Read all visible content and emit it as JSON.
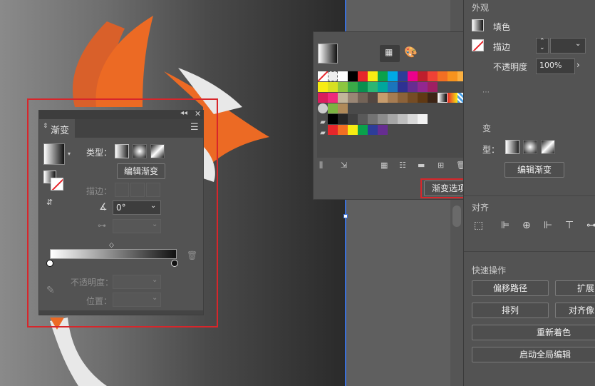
{
  "gradient_panel": {
    "tab_title": "渐变",
    "type_label": "类型：",
    "edit_gradient_button": "编辑渐变",
    "stroke_label": "描边：",
    "angle_value": "0°",
    "opacity_label": "不透明度：",
    "location_label": "位置："
  },
  "swatches_panel": {
    "gradient_options_button": "渐变选项",
    "row1_colors": [
      "#ffffff",
      "#000000",
      "#e7262b",
      "#f7ec13",
      "#0aa14b",
      "#00a9e6",
      "#2d3d98",
      "#ec008c",
      "#be1e2d",
      "#ef4136",
      "#f26f23",
      "#f7931e",
      "#fbb040"
    ],
    "row2_colors": [
      "#f7ec13",
      "#d7df21",
      "#8dc63f",
      "#3aa948",
      "#0a8f4f",
      "#2bb673",
      "#00a79d",
      "#1b75bc",
      "#2e3192",
      "#662d91",
      "#92278f",
      "#9e1f63"
    ],
    "row3_colors": [
      "#da1c5c",
      "#ee2a7b",
      "#c2b59b",
      "#998675",
      "#736357",
      "#534741",
      "#c69c6d",
      "#a67c52",
      "#8c6239",
      "#754c24",
      "#603913",
      "#3c2415"
    ],
    "row5_colors": [
      "#000000",
      "#262626",
      "#404040",
      "#595959",
      "#737373",
      "#8c8c8c",
      "#a6a6a6",
      "#bfbfbf",
      "#d9d9d9",
      "#f2f2f2"
    ],
    "row6_colors": [
      "#e7262b",
      "#f26f23",
      "#f7ec13",
      "#0aa14b",
      "#2d3d98",
      "#662d91"
    ]
  },
  "properties_panel": {
    "appearance_title": "外观",
    "fill_label": "填色",
    "stroke_label": "描边",
    "opacity_label": "不透明度",
    "opacity_value": "100%",
    "gradient_section_partial": "变",
    "type_partial": "型：",
    "edit_gradient_button": "编辑渐变",
    "align_title": "对齐",
    "quick_actions_title": "快速操作",
    "offset_path_button": "偏移路径",
    "expand_button_partial": "扩展",
    "arrange_button": "排列",
    "align_pixel_partial": "对齐像",
    "recolor_button": "重新着色",
    "global_edit_button": "启动全局编辑"
  },
  "colors": {
    "highlight_red": "#d7262b",
    "panel_bg": "#535353",
    "guide_blue": "#3a6fd8"
  }
}
